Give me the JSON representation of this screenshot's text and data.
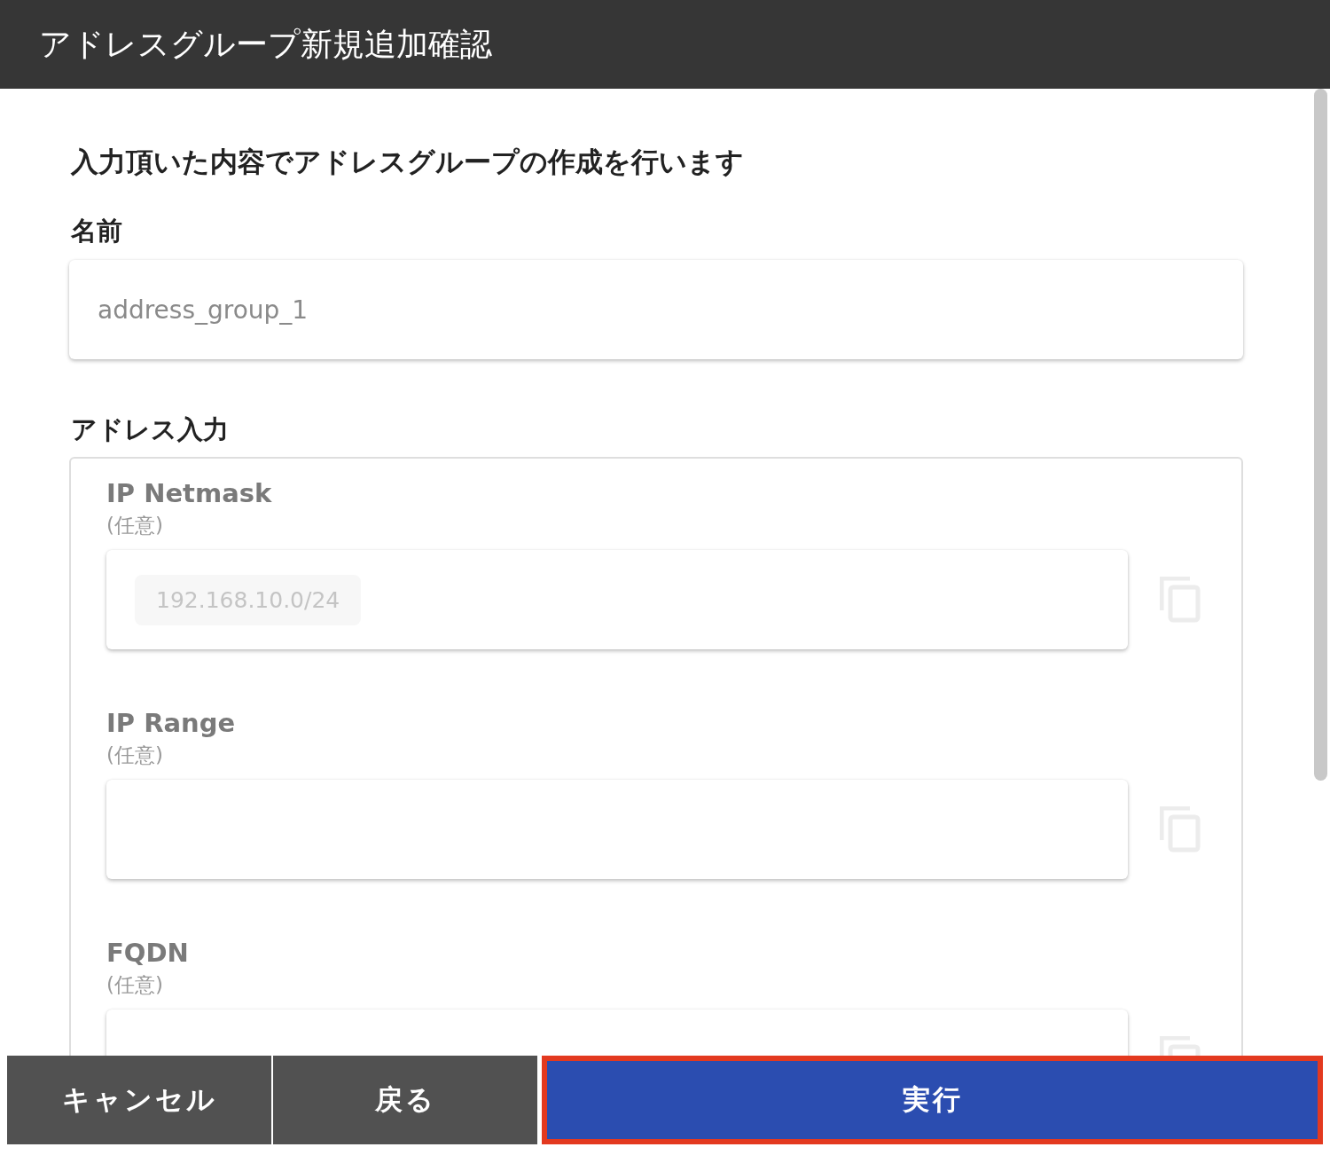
{
  "window": {
    "title": "アドレスグループ新規追加確認"
  },
  "message": "入力頂いた内容でアドレスグループの作成を行います",
  "name_field": {
    "label": "名前",
    "value": "address_group_1"
  },
  "address_section": {
    "label": "アドレス入力",
    "fields": [
      {
        "label": "IP Netmask",
        "note": "(任意)",
        "values": [
          "192.168.10.0/24"
        ]
      },
      {
        "label": "IP Range",
        "note": "(任意)"
      },
      {
        "label": "FQDN",
        "note": "(任意)"
      }
    ]
  },
  "buttons": [
    {
      "label": "キャンセル",
      "kind": "secondary",
      "highlighted": false
    },
    {
      "label": "戻る",
      "kind": "secondary",
      "highlighted": false
    },
    {
      "label": "実行",
      "kind": "primary",
      "highlighted": true
    }
  ]
}
